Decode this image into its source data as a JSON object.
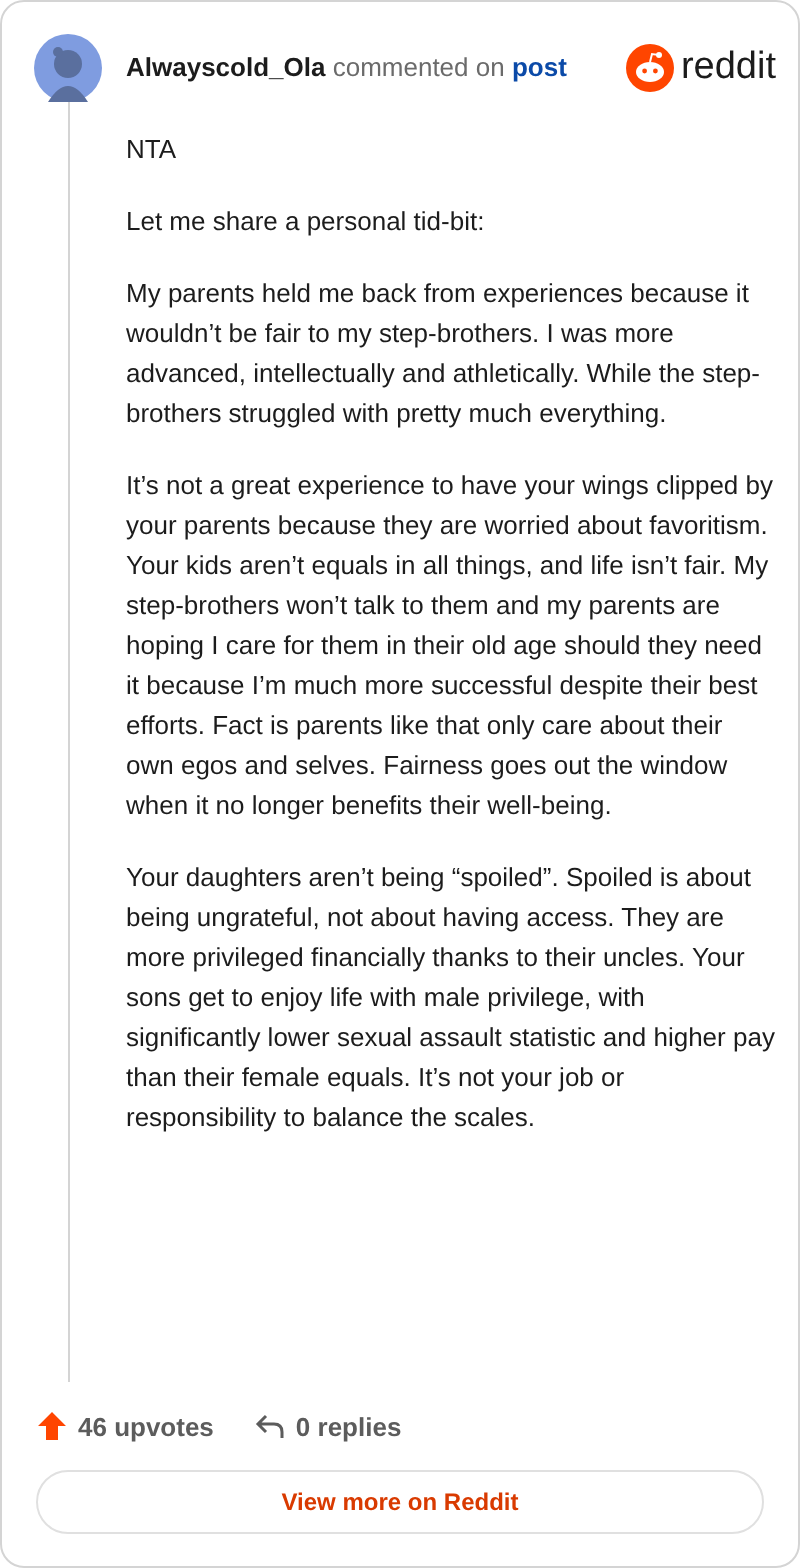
{
  "comment": {
    "author": "Alwayscold_Ola",
    "action": "commented on",
    "link": "post",
    "brand": "reddit",
    "paragraphs": [
      "NTA",
      "Let me share a personal tid-bit:",
      "My parents held me back from experiences because it wouldn’t be fair to my step-brothers. I was more advanced, intellectually and athletically. While the step-brothers struggled with pretty much everything.",
      "It’s not a great experience to have your wings clipped by your parents because they are worried about favoritism. Your kids aren’t equals in all things, and life isn’t fair. My step-brothers won’t talk to them and my parents are hoping I care for them in their old age should they need it because I’m much more successful despite their best efforts. Fact is parents like that only care about their own egos and selves. Fairness goes out the window when it no longer benefits their well-being.",
      "Your daughters aren’t being “spoiled”. Spoiled is about being ungrateful, not about having access. They are more privileged financially thanks to their uncles. Your sons get to enjoy life with male privilege, with significantly lower sexual assault statistic and higher pay than their female equals. It’s not your job or responsibility to balance the scales."
    ]
  },
  "footer": {
    "upvotes": "46 upvotes",
    "replies": "0 replies",
    "button": "View more on Reddit"
  }
}
